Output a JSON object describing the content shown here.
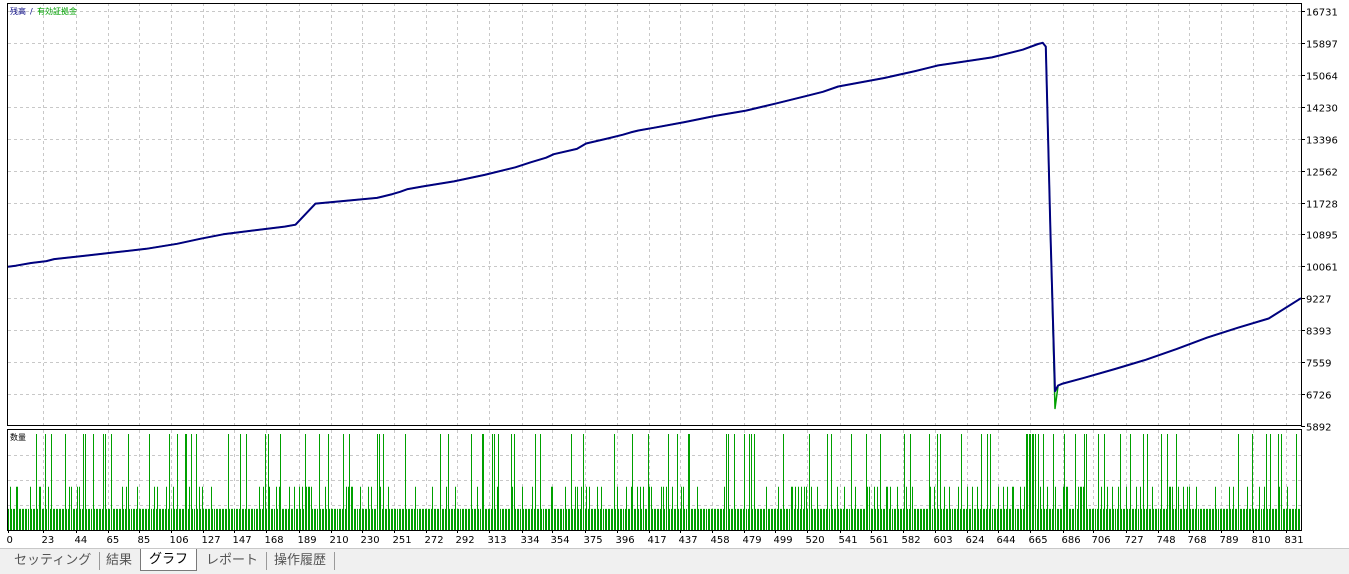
{
  "chart_data": [
    {
      "type": "line",
      "title": "",
      "legend_labels": [
        "残高",
        "/",
        "有効証拠金"
      ],
      "colors": {
        "balance": "#00007f",
        "equity": "#00a000",
        "grid": "#c8c8c8"
      },
      "grid": true,
      "ylim": [
        5892,
        16731
      ],
      "y_ticks": [
        16731,
        15897,
        15064,
        14230,
        13396,
        12562,
        11728,
        10895,
        10061,
        9227,
        8393,
        7559,
        6726,
        5892
      ],
      "x_ticks": [
        0,
        23,
        44,
        65,
        85,
        106,
        127,
        147,
        168,
        189,
        210,
        230,
        251,
        272,
        292,
        313,
        334,
        354,
        375,
        396,
        417,
        437,
        458,
        479,
        499,
        520,
        541,
        561,
        582,
        603,
        624,
        644,
        665,
        686,
        706,
        727,
        748,
        768,
        789,
        810,
        831
      ],
      "xlim": [
        0,
        841
      ],
      "series": [
        {
          "name": "残高",
          "x": [
            0,
            5,
            15,
            25,
            30,
            50,
            70,
            90,
            110,
            125,
            140,
            160,
            180,
            187,
            200,
            240,
            250,
            255,
            260,
            270,
            290,
            310,
            330,
            340,
            350,
            355,
            370,
            376,
            390,
            400,
            405,
            410,
            420,
            440,
            460,
            480,
            500,
            520,
            530,
            540,
            570,
            590,
            600,
            605,
            620,
            640,
            660,
            670,
            673,
            675,
            678,
            681,
            683,
            686,
            700,
            720,
            740,
            760,
            780,
            800,
            820,
            841
          ],
          "values": [
            10050,
            10080,
            10150,
            10200,
            10250,
            10340,
            10430,
            10520,
            10650,
            10780,
            10900,
            11000,
            11100,
            11150,
            11700,
            11850,
            11950,
            12010,
            12080,
            12150,
            12280,
            12450,
            12650,
            12780,
            12900,
            12990,
            13130,
            13270,
            13400,
            13500,
            13560,
            13610,
            13680,
            13830,
            13990,
            14130,
            14320,
            14520,
            14620,
            14760,
            14980,
            15160,
            15260,
            15310,
            15400,
            15520,
            15720,
            15870,
            15900,
            15800,
            11000,
            6800,
            6950,
            7000,
            7150,
            7380,
            7620,
            7900,
            8200,
            8460,
            8700,
            9230
          ]
        },
        {
          "name": "有効証拠金",
          "x": [
            0,
            5,
            15,
            25,
            30,
            50,
            70,
            90,
            110,
            125,
            140,
            160,
            180,
            187,
            200,
            240,
            250,
            255,
            260,
            270,
            290,
            310,
            330,
            340,
            350,
            355,
            370,
            376,
            390,
            400,
            405,
            410,
            420,
            440,
            460,
            480,
            500,
            520,
            530,
            540,
            570,
            590,
            600,
            605,
            620,
            640,
            660,
            670,
            673,
            675,
            678,
            681,
            683,
            686,
            700,
            720,
            740,
            760,
            780,
            800,
            820,
            841
          ],
          "values": [
            10050,
            10080,
            10150,
            10200,
            10250,
            10340,
            10430,
            10520,
            10650,
            10780,
            10900,
            11000,
            11100,
            11150,
            11700,
            11850,
            11950,
            12010,
            12080,
            12150,
            12280,
            12450,
            12650,
            12780,
            12900,
            12990,
            13130,
            13270,
            13400,
            13500,
            13560,
            13610,
            13680,
            13830,
            13990,
            14130,
            14320,
            14520,
            14620,
            14760,
            14980,
            15160,
            15260,
            15310,
            15400,
            15520,
            15720,
            15870,
            15900,
            15800,
            11000,
            6350,
            6950,
            7000,
            7150,
            7380,
            7620,
            7900,
            8200,
            8460,
            8700,
            9230
          ]
        }
      ]
    },
    {
      "type": "bar",
      "title": "",
      "legend_labels": [
        "数量"
      ],
      "colors": {
        "bar": "#00a000"
      },
      "grid": true,
      "xlim": [
        0,
        841
      ],
      "ylim": [
        0,
        1
      ],
      "levels": [
        0.22,
        0.45,
        1.0
      ],
      "series": [
        {
          "name": "数量",
          "values": "one bar per trade index 0–841; baseline level ≈0.22, many at ≈0.45, tall spikes at 1.0"
        }
      ]
    }
  ],
  "tabs": [
    {
      "label": "セッティング",
      "active": false
    },
    {
      "label": "結果",
      "active": false
    },
    {
      "label": "グラフ",
      "active": true
    },
    {
      "label": "レポート",
      "active": false
    },
    {
      "label": "操作履歴",
      "active": false
    }
  ]
}
